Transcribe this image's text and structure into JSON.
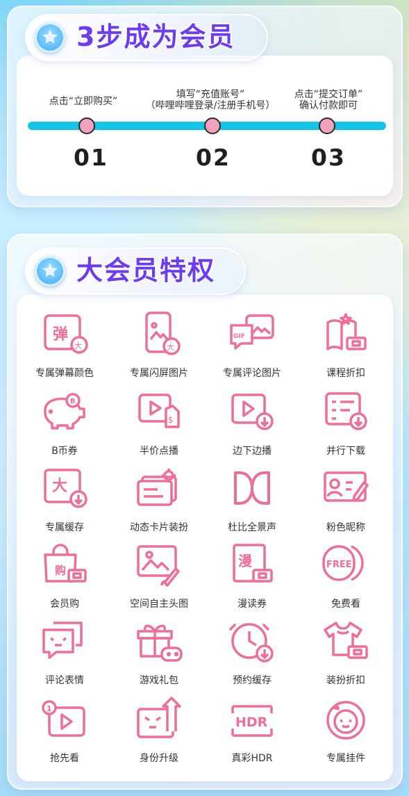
{
  "steps_card": {
    "title": "3步成为会员",
    "steps": [
      {
        "line1": "点击“立即购买”",
        "line2": "",
        "number": "01"
      },
      {
        "line1": "填写“充值账号”",
        "line2": "（哔哩哔哩登录/注册手机号）",
        "number": "02"
      },
      {
        "line1": "点击“提交订单”",
        "line2": "确认付款即可",
        "number": "03"
      }
    ]
  },
  "privileges_card": {
    "title": "大会员特权",
    "items": [
      {
        "label": "专属弹幕颜色",
        "icon": "danmaku-color-icon"
      },
      {
        "label": "专属闪屏图片",
        "icon": "splash-image-icon"
      },
      {
        "label": "专属评论图片",
        "icon": "comment-image-icon"
      },
      {
        "label": "课程折扣",
        "icon": "course-discount-icon"
      },
      {
        "label": "B币券",
        "icon": "piggy-bank-icon"
      },
      {
        "label": "半价点播",
        "icon": "half-price-video-icon"
      },
      {
        "label": "边下边播",
        "icon": "download-play-icon"
      },
      {
        "label": "并行下载",
        "icon": "parallel-download-icon"
      },
      {
        "label": "专属缓存",
        "icon": "exclusive-cache-icon"
      },
      {
        "label": "动态卡片装扮",
        "icon": "dynamic-card-icon"
      },
      {
        "label": "杜比全景声",
        "icon": "dolby-icon"
      },
      {
        "label": "粉色昵称",
        "icon": "pink-nickname-icon"
      },
      {
        "label": "会员购",
        "icon": "shopping-bag-icon"
      },
      {
        "label": "空间自主头图",
        "icon": "space-header-icon"
      },
      {
        "label": "漫读券",
        "icon": "manga-coupon-icon"
      },
      {
        "label": "免费看",
        "icon": "free-watch-icon"
      },
      {
        "label": "评论表情",
        "icon": "comment-emoji-icon"
      },
      {
        "label": "游戏礼包",
        "icon": "game-gift-icon"
      },
      {
        "label": "预约缓存",
        "icon": "scheduled-cache-icon"
      },
      {
        "label": "装扮折扣",
        "icon": "outfit-discount-icon"
      },
      {
        "label": "抢先看",
        "icon": "early-access-icon"
      },
      {
        "label": "身份升级",
        "icon": "identity-upgrade-icon"
      },
      {
        "label": "真彩HDR",
        "icon": "hdr-icon"
      },
      {
        "label": "专属挂件",
        "icon": "avatar-pendant-icon"
      }
    ]
  },
  "colors": {
    "icon_pink": "#ee6f95",
    "track_cyan": "#16c4e6",
    "title_purple": "#6d3cf2",
    "dot_pink": "#f3a2be"
  }
}
